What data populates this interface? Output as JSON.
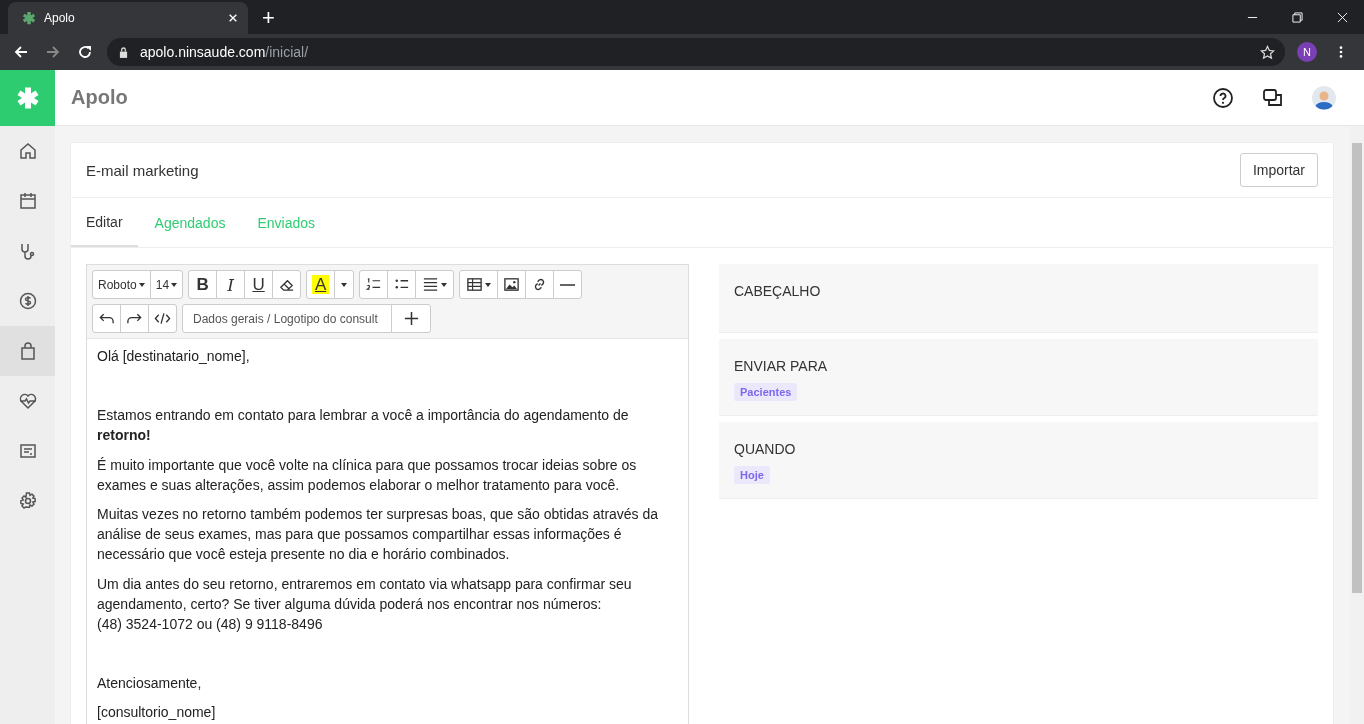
{
  "browser": {
    "tab_title": "Apolo",
    "new_tab": "+",
    "url_host": "apolo.ninsaude.com",
    "url_path": "/inicial/",
    "profile_initial": "N"
  },
  "app": {
    "title": "Apolo"
  },
  "sidebar": {
    "items": [
      {
        "selected": false
      },
      {
        "selected": false
      },
      {
        "selected": false
      },
      {
        "selected": false
      },
      {
        "selected": true
      },
      {
        "selected": false
      },
      {
        "selected": false
      },
      {
        "selected": false
      }
    ]
  },
  "page": {
    "title": "E-mail marketing",
    "import_button": "Importar"
  },
  "tabs": [
    {
      "label": "Editar",
      "selected": true
    },
    {
      "label": "Agendados",
      "selected": false
    },
    {
      "label": "Enviados",
      "selected": false
    }
  ],
  "toolbar": {
    "font": "Roboto",
    "size": "14",
    "bold": "B",
    "italic": "I",
    "underline": "U",
    "text_color": "A",
    "merge_field": "Dados gerais / Logotipo do consult"
  },
  "body": [
    {
      "kind": "text",
      "lines": [
        "Olá [destinatario_nome],"
      ]
    },
    {
      "kind": "blank"
    },
    {
      "kind": "text",
      "lines": [
        "Estamos entrando em contato para lembrar a você a importância do agendamento de **retorno!**"
      ]
    },
    {
      "kind": "text",
      "lines": [
        "É muito importante que você volte na clínica para que possamos trocar ideias sobre os exames e suas alterações, assim podemos elaborar o melhor tratamento para você."
      ]
    },
    {
      "kind": "text",
      "lines": [
        "Muitas vezes no retorno também podemos ter surpresas boas, que são obtidas através da análise de seus exames, mas para que possamos compartilhar essas informações é necessário que você esteja presente no dia e horário combinados."
      ]
    },
    {
      "kind": "text",
      "lines": [
        "Um dia antes do seu retorno, entraremos em contato via whatsapp para confirmar seu agendamento, certo? Se tiver alguma dúvida poderá nos encontrar nos números:",
        "(48) 3524-1072 ou (48) 9 9118-8496"
      ]
    },
    {
      "kind": "blank"
    },
    {
      "kind": "text",
      "lines": [
        "Atenciosamente,"
      ]
    },
    {
      "kind": "text",
      "lines": [
        "[consultorio_nome]"
      ]
    }
  ],
  "sections": [
    {
      "title": "CABEÇALHO"
    },
    {
      "title": "ENVIAR PARA",
      "tag": "Pacientes"
    },
    {
      "title": "QUANDO",
      "tag": "Hoje"
    }
  ]
}
